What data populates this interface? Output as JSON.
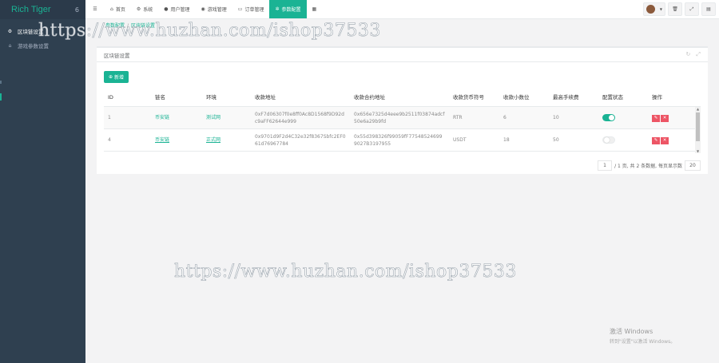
{
  "sidebar": {
    "brand": "Rich Tiger",
    "brand_badge": "6",
    "items": [
      {
        "label": "区块链设置",
        "icon": "gear-icon"
      },
      {
        "label": "游戏参数设置",
        "icon": "home-icon"
      }
    ]
  },
  "topnav": {
    "items": [
      {
        "label": "首页",
        "icon": "home-icon"
      },
      {
        "label": "系统",
        "icon": "gear-icon"
      },
      {
        "label": "用户管理",
        "icon": "user-icon"
      },
      {
        "label": "游戏管理",
        "icon": "gamepad-icon"
      },
      {
        "label": "订单管理",
        "icon": "card-icon"
      },
      {
        "label": "参数配置",
        "icon": "cog-icon"
      }
    ]
  },
  "breadcrumb": [
    "参数配置",
    "区块链设置"
  ],
  "panel": {
    "title": "区块链设置",
    "add_label": "新增"
  },
  "table": {
    "columns": [
      "ID",
      "链名",
      "环境",
      "收款地址",
      "收款合约地址",
      "收款货币符号",
      "收款小数位",
      "最高手续费",
      "配置状态",
      "操作"
    ],
    "rows": [
      {
        "id": "1",
        "chain": "币安链",
        "env": "测试网",
        "addr": "0xF7d06307f0e8ff0Ac8D1568f9D92dc9aFF62644e999",
        "caddr": "0x656e7325d4eee9b2511f03874adcf50e6a29b9fd",
        "symbol": "RTR",
        "decimals": "6",
        "fee": "10",
        "state_on": true
      },
      {
        "id": "4",
        "chain": "币安链",
        "env": "正式网",
        "addr": "0x9701d9F2d4C32e32f8367Sbfc2EF061d76967784",
        "caddr": "0x55d398326f99059fF775485246999027B3197955",
        "symbol": "USDT",
        "decimals": "18",
        "fee": "50",
        "state_on": false
      }
    ]
  },
  "pager": {
    "page": "1",
    "summary": "/ 1 页, 共 2 条数据, 每页显示数",
    "page_size": "20"
  },
  "watermark": "https://www.huzhan.com/ishop37533",
  "activate": {
    "title": "激活 Windows",
    "sub": "转到\"设置\"以激活 Windows。"
  }
}
